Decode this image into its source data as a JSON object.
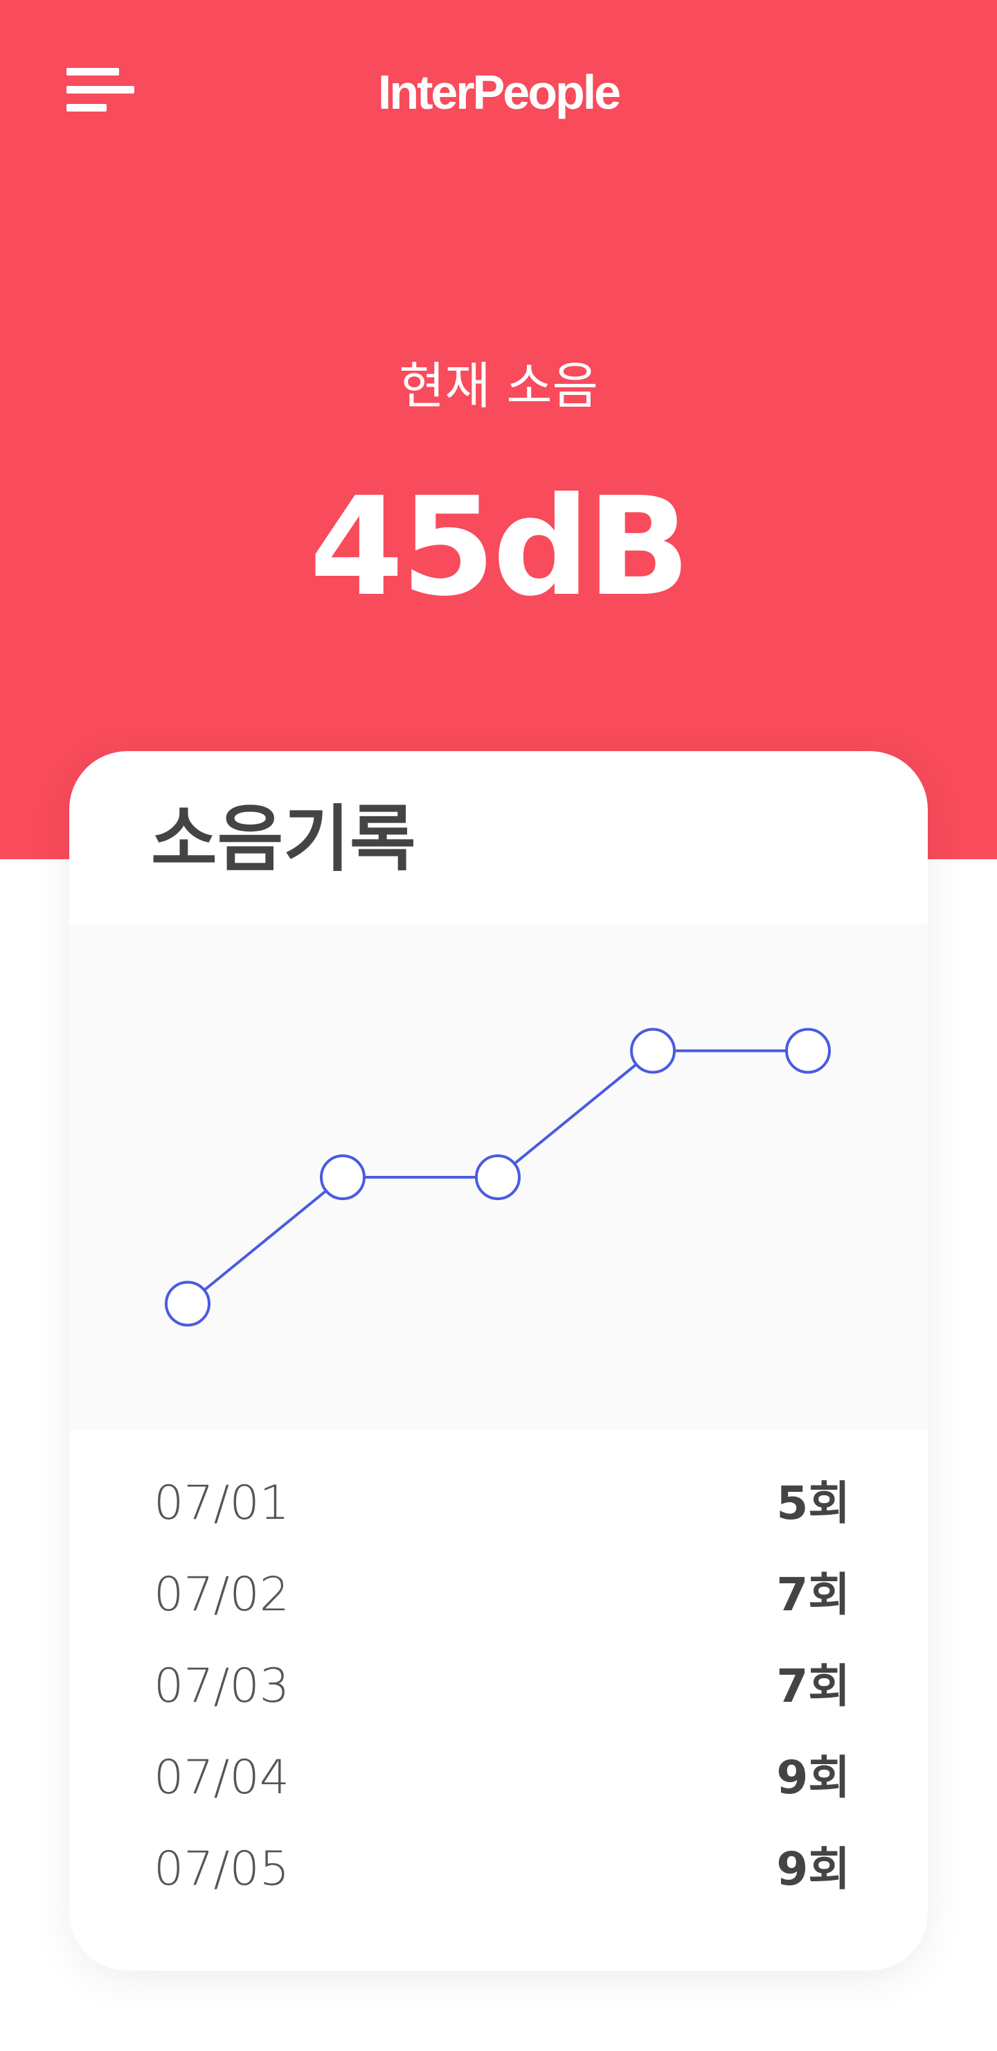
{
  "header": {
    "title": "InterPeople",
    "menu_icon": "hamburger-menu-icon"
  },
  "current_noise": {
    "label": "현재 소음",
    "value": "45dB"
  },
  "record_card": {
    "title": "소음기록",
    "rows": [
      {
        "date": "07/01",
        "count": "5회"
      },
      {
        "date": "07/02",
        "count": "7회"
      },
      {
        "date": "07/03",
        "count": "7회"
      },
      {
        "date": "07/04",
        "count": "9회"
      },
      {
        "date": "07/05",
        "count": "9회"
      }
    ]
  },
  "chart_data": {
    "type": "line",
    "categories": [
      "07/01",
      "07/02",
      "07/03",
      "07/04",
      "07/05"
    ],
    "values": [
      5,
      7,
      7,
      9,
      9
    ],
    "ylim": [
      3,
      11
    ],
    "grid": false,
    "line_color": "#4a5be0"
  },
  "colors": {
    "accent": "#f84b5b",
    "chart_line": "#4a5be0",
    "text_dark": "#444444"
  }
}
